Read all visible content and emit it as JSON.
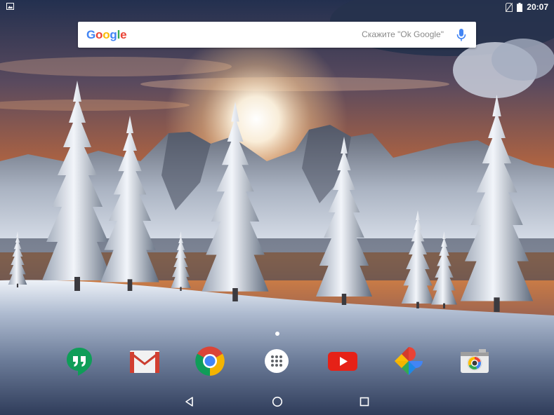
{
  "status_bar": {
    "time": "20:07",
    "left_icon": "image-notification-icon",
    "right_icons": [
      "no-sim-icon",
      "battery-icon"
    ]
  },
  "search_widget": {
    "logo_letters": [
      {
        "char": "G",
        "color": "#4285F4"
      },
      {
        "char": "o",
        "color": "#EA4335"
      },
      {
        "char": "o",
        "color": "#FBBC05"
      },
      {
        "char": "g",
        "color": "#4285F4"
      },
      {
        "char": "l",
        "color": "#34A853"
      },
      {
        "char": "e",
        "color": "#EA4335"
      }
    ],
    "hint": "Скажите \"Ok Google\"",
    "mic_icon": "microphone-icon",
    "mic_color": "#4285F4"
  },
  "home": {
    "page_indicator": {
      "pages": 1,
      "current": 1
    }
  },
  "dock": {
    "apps": [
      {
        "icon": "hangouts-icon"
      },
      {
        "icon": "gmail-icon"
      },
      {
        "icon": "chrome-icon"
      },
      {
        "icon": "app-drawer-icon"
      },
      {
        "icon": "youtube-icon"
      },
      {
        "icon": "photos-icon"
      },
      {
        "icon": "camera-icon"
      }
    ]
  },
  "nav_bar": {
    "buttons": [
      "back-icon",
      "home-icon",
      "recents-icon"
    ]
  }
}
